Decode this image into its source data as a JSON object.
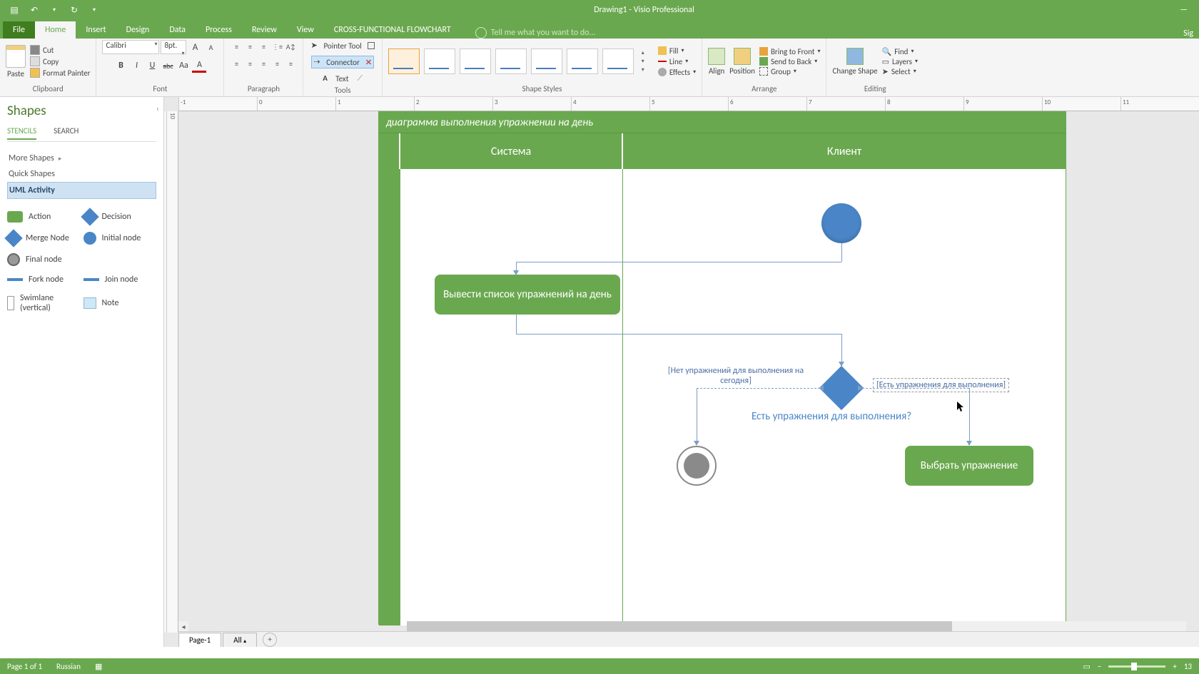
{
  "app": {
    "title": "Drawing1 - Visio Professional",
    "signin": "Sig"
  },
  "tabs": {
    "file": "File",
    "home": "Home",
    "insert": "Insert",
    "design": "Design",
    "data": "Data",
    "process": "Process",
    "review": "Review",
    "view": "View",
    "funcflow": "CROSS-FUNCTIONAL FLOWCHART",
    "tellme": "Tell me what you want to do..."
  },
  "ribbon": {
    "clipboard": {
      "label": "Clipboard",
      "paste": "Paste",
      "cut": "Cut",
      "copy": "Copy",
      "fp": "Format Painter"
    },
    "font": {
      "label": "Font",
      "name": "Calibri",
      "size": "8pt.",
      "b": "B",
      "i": "I",
      "u": "U",
      "s": "abc",
      "aa": "Aa",
      "a": "A"
    },
    "paragraph": {
      "label": "Paragraph"
    },
    "tools": {
      "label": "Tools",
      "pointer": "Pointer Tool",
      "connector": "Connector",
      "text": "Text"
    },
    "styles": {
      "label": "Shape Styles",
      "fill": "Fill",
      "line": "Line",
      "effects": "Effects"
    },
    "arrange": {
      "label": "Arrange",
      "align": "Align",
      "position": "Position",
      "btf": "Bring to Front",
      "stb": "Send to Back",
      "group": "Group"
    },
    "editing": {
      "label": "Editing",
      "change": "Change Shape",
      "find": "Find",
      "layers": "Layers",
      "select": "Select"
    }
  },
  "panel": {
    "title": "Shapes",
    "stencils": "STENCILS",
    "search": "SEARCH",
    "more": "More Shapes",
    "quick": "Quick Shapes",
    "active": "UML Activity",
    "shapes": {
      "action": "Action",
      "decision": "Decision",
      "merge": "Merge Node",
      "initial": "Initial node",
      "final": "Final node",
      "fork": "Fork node",
      "join": "Join node",
      "swim": "Swimlane (vertical)",
      "note": "Note"
    }
  },
  "diagram": {
    "title": "диаграмма выполнения упражнении на день",
    "lanes": {
      "sys": "Система",
      "client": "Клиент"
    },
    "action1": "Вывести список упражнений на день",
    "action2": "Выбрать упражнение",
    "cond_no": "[Нет упражнений для выполнения на сегодня]",
    "cond_yes": "[Есть упражнения для выполнения]",
    "question": "Есть упражнения для выполнения?"
  },
  "pages": {
    "p1": "Page-1",
    "all": "All"
  },
  "status": {
    "page": "Page 1 of 1",
    "lang": "Russian",
    "zoom": "13"
  }
}
